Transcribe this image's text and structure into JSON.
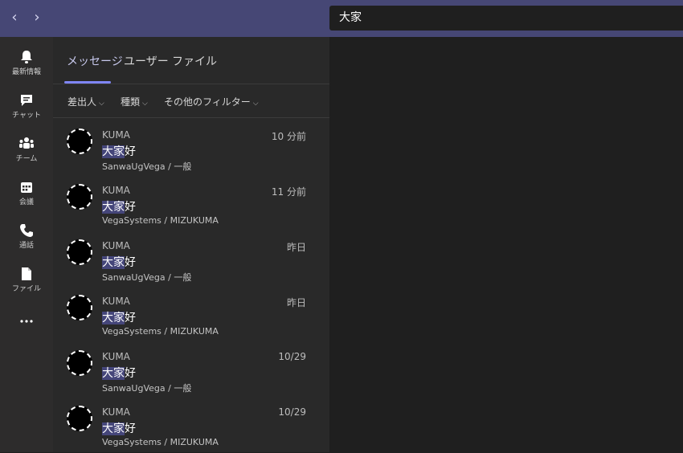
{
  "search": {
    "query": "大家"
  },
  "rail": [
    {
      "label": "最新情報",
      "icon": "bell-icon"
    },
    {
      "label": "チャット",
      "icon": "chat-icon"
    },
    {
      "label": "チーム",
      "icon": "teams-icon"
    },
    {
      "label": "会議",
      "icon": "calendar-icon"
    },
    {
      "label": "通話",
      "icon": "phone-icon"
    },
    {
      "label": "ファイル",
      "icon": "file-icon"
    }
  ],
  "tabs": {
    "messages": "メッセージ",
    "users": "ユーザー",
    "files": "ファイル"
  },
  "filters": {
    "sender": "差出人",
    "type": "種類",
    "more": "その他のフィルター"
  },
  "results": [
    {
      "author": "KUMA",
      "time": "10 分前",
      "highlight": "大家",
      "rest": "好",
      "location": "SanwaUgVega / 一般"
    },
    {
      "author": "KUMA",
      "time": "11 分前",
      "highlight": "大家",
      "rest": "好",
      "location": "VegaSystems / MIZUKUMA"
    },
    {
      "author": "KUMA",
      "time": "昨日",
      "highlight": "大家",
      "rest": "好",
      "location": "SanwaUgVega / 一般"
    },
    {
      "author": "KUMA",
      "time": "昨日",
      "highlight": "大家",
      "rest": "好",
      "location": "VegaSystems / MIZUKUMA"
    },
    {
      "author": "KUMA",
      "time": "10/29",
      "highlight": "大家",
      "rest": "好",
      "location": "SanwaUgVega / 一般"
    },
    {
      "author": "KUMA",
      "time": "10/29",
      "highlight": "大家",
      "rest": "好",
      "location": "VegaSystems / MIZUKUMA"
    }
  ],
  "colors": {
    "topbar": "#464775",
    "accent": "#7f85f5",
    "highlight": "#45467a"
  }
}
